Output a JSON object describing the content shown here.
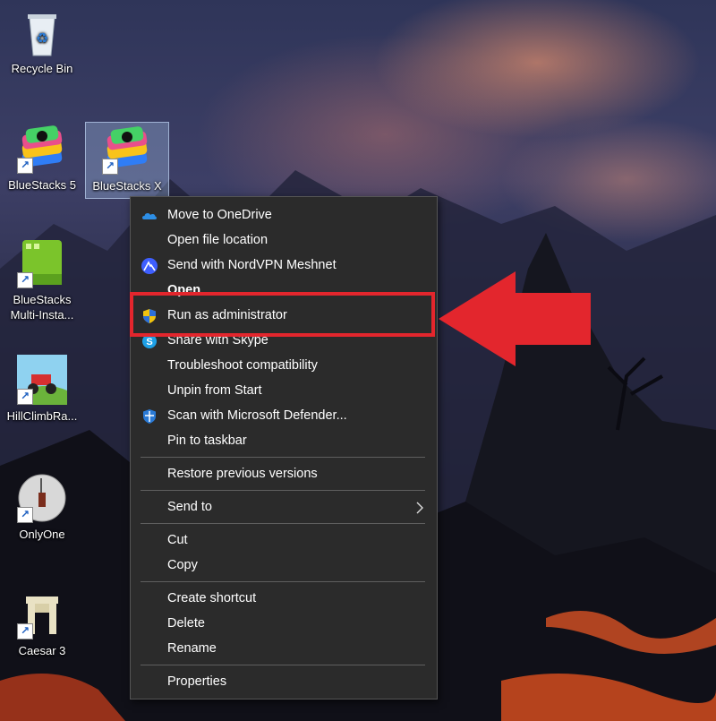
{
  "desktop": {
    "icons": [
      {
        "label": "Recycle Bin",
        "icon": "recycle-bin-icon"
      },
      {
        "label": "BlueStacks 5",
        "icon": "bluestacks-icon"
      },
      {
        "label": "BlueStacks X",
        "icon": "bluestacks-icon"
      },
      {
        "label": "BlueStacks Multi-Insta...",
        "icon": "bluestacks-multi-instance-icon"
      },
      {
        "label": "HillClimbRa...",
        "icon": "hill-climb-racing-icon"
      },
      {
        "label": "OnlyOne",
        "icon": "onlyone-icon"
      },
      {
        "label": "Caesar 3",
        "icon": "caesar-icon"
      }
    ]
  },
  "context_menu": {
    "items": {
      "onedrive": "Move to OneDrive",
      "open_location": "Open file location",
      "nordvpn": "Send with NordVPN Meshnet",
      "open": "Open",
      "run_admin": "Run as administrator",
      "skype": "Share with Skype",
      "troubleshoot": "Troubleshoot compatibility",
      "unpin": "Unpin from Start",
      "defender": "Scan with Microsoft Defender...",
      "pin_taskbar": "Pin to taskbar",
      "restore": "Restore previous versions",
      "send_to": "Send to",
      "cut": "Cut",
      "copy": "Copy",
      "create_shortcut": "Create shortcut",
      "delete": "Delete",
      "rename": "Rename",
      "properties": "Properties"
    }
  },
  "colors": {
    "menu_bg": "#2b2b2b",
    "highlight": "#e3262d"
  }
}
